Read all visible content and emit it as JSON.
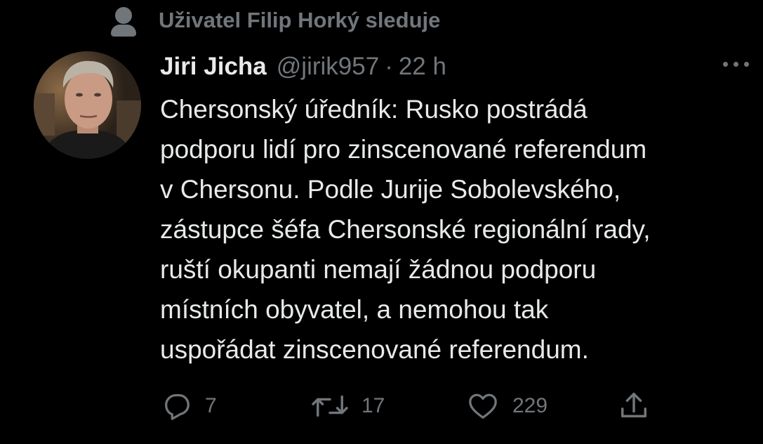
{
  "context": {
    "text": "Uživatel Filip Horký sleduje",
    "icon": "person-icon"
  },
  "author": {
    "name": "Jiri Jicha",
    "handle": "@jirik957",
    "separator": "·",
    "time": "22 h"
  },
  "tweet": {
    "lines": [
      "Chersonský úředník: Rusko postrádá",
      "podporu lidí pro zinscenované referendum",
      "v Chersonu. Podle Jurije Sobolevského,",
      "zástupce šéfa Chersonské regionální rady,",
      "ruští okupanti nemají žádnou podporu",
      "místních obyvatel, a nemohou tak",
      "uspořádat zinscenované referendum."
    ]
  },
  "actions": {
    "reply": {
      "icon": "reply-icon",
      "count": "7"
    },
    "retweet": {
      "icon": "retweet-icon",
      "count": "17"
    },
    "like": {
      "icon": "heart-icon",
      "count": "229"
    },
    "share": {
      "icon": "share-icon"
    }
  },
  "colors": {
    "background": "#000000",
    "text": "#e7e9ea",
    "secondary": "#71767b"
  }
}
